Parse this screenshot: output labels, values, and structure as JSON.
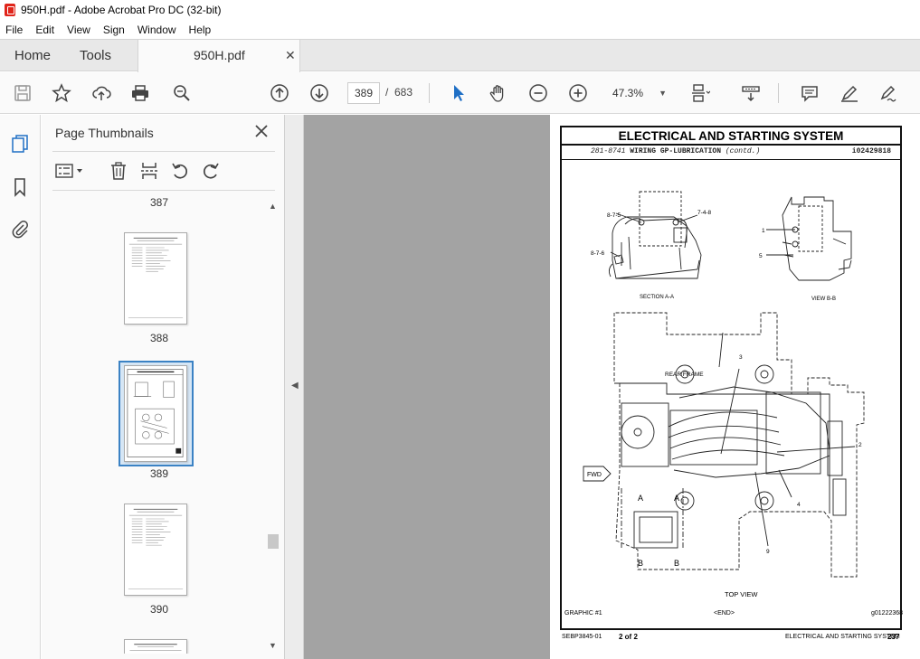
{
  "window": {
    "title": "950H.pdf - Adobe Acrobat Pro DC (32-bit)"
  },
  "menu": [
    "File",
    "Edit",
    "View",
    "Sign",
    "Window",
    "Help"
  ],
  "tabs": {
    "home": "Home",
    "tools": "Tools",
    "document": "950H.pdf"
  },
  "toolbar": {
    "current_page": "389",
    "separator": "/",
    "total_pages": "683",
    "zoom": "47.3%"
  },
  "thumbnails": {
    "title": "Page Thumbnails",
    "pages": [
      "387",
      "388",
      "389",
      "390"
    ],
    "selected": "389"
  },
  "document": {
    "heading": "ELECTRICAL AND STARTING SYSTEM",
    "subheading_number": "281-8741",
    "subheading_title": "WIRING GP-LUBRICATION",
    "subheading_contd": "(contd.)",
    "subheading_code": "i02429818",
    "labels": {
      "section_aa": "SECTION A-A",
      "view_bb": "VIEW B-B",
      "rear_frame": "REAR FRAME",
      "fwd": "FWD",
      "top_view": "TOP VIEW",
      "callout_875": "8-7-5",
      "callout_748": "7-4-8",
      "callout_876": "8-7-6",
      "callout_1": "1",
      "callout_2": "2",
      "callout_3": "3",
      "callout_4": "4",
      "callout_5": "5",
      "callout_9": "9",
      "letter_a": "A",
      "letter_b": "B"
    },
    "graphic_label": "GRAPHIC #1",
    "end_label": "<END>",
    "graphic_code": "g01222368",
    "footer_doc": "SEBP3845-01",
    "footer_page_of": "2 of 2",
    "footer_section": "ELECTRICAL AND STARTING SYSTEM",
    "footer_page_number": "237"
  }
}
